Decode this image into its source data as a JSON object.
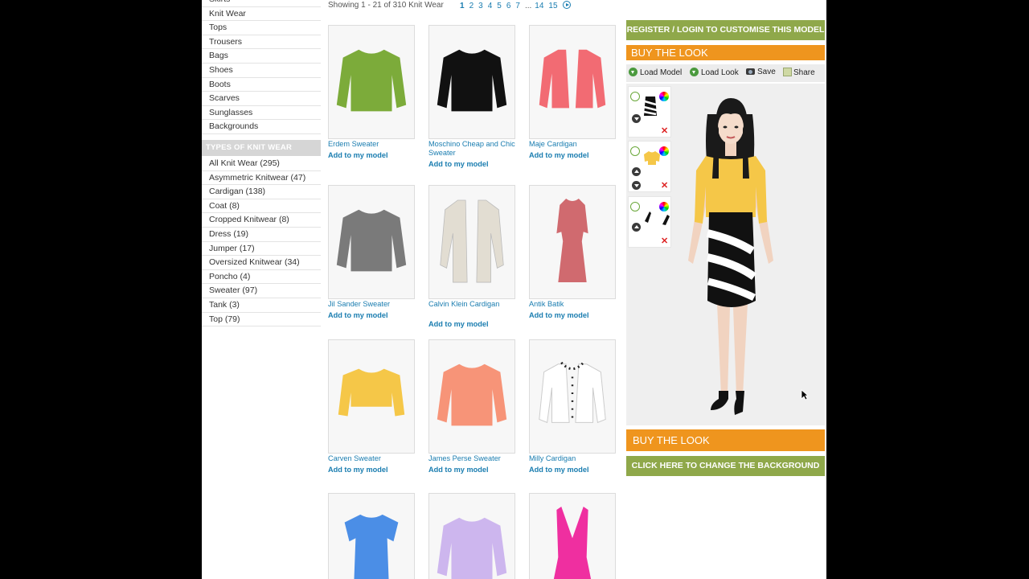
{
  "sidebar": {
    "categories": [
      "Skirts",
      "Knit Wear",
      "Tops",
      "Trousers",
      "Bags",
      "Shoes",
      "Boots",
      "Scarves",
      "Sunglasses",
      "Backgrounds"
    ],
    "types_header": "TYPES OF KNIT WEAR",
    "types": [
      "All Knit Wear (295)",
      "Asymmetric Knitwear (47)",
      "Cardigan (138)",
      "Coat (8)",
      "Cropped Knitwear (8)",
      "Dress (19)",
      "Jumper (17)",
      "Oversized Knitwear (34)",
      "Poncho (4)",
      "Sweater (97)",
      "Tank (3)",
      "Top (79)"
    ]
  },
  "results": {
    "info": "Showing 1 - 21 of 310 Knit Wear",
    "pages": [
      "1",
      "2",
      "3",
      "4",
      "5",
      "6",
      "7"
    ],
    "ellipsis": "...",
    "last_pages": [
      "14",
      "15"
    ]
  },
  "add_label": "Add to my model",
  "products": [
    {
      "name": "Erdem Sweater",
      "color": "#7cab3a",
      "shape": "sweater"
    },
    {
      "name": "Moschino Cheap and Chic Sweater",
      "color": "#111111",
      "shape": "sweater"
    },
    {
      "name": "Maje Cardigan",
      "color": "#f26b73",
      "shape": "cardigan"
    },
    {
      "name": "Jil Sander Sweater",
      "color": "#7a7a7a",
      "shape": "sweater"
    },
    {
      "name": "Calvin Klein Cardigan",
      "color": "#e2ddd2",
      "shape": "longcardigan"
    },
    {
      "name": "Antik Batik",
      "color": "#d06a6f",
      "shape": "gown"
    },
    {
      "name": "Carven Sweater",
      "color": "#f5c748",
      "shape": "crop"
    },
    {
      "name": "James Perse Sweater",
      "color": "#f79478",
      "shape": "sweater"
    },
    {
      "name": "Milly Cardigan",
      "color": "#ffffff",
      "shape": "cardigan"
    },
    {
      "name": "",
      "color": "#4b8ee6",
      "shape": "dress"
    },
    {
      "name": "",
      "color": "#cdb6ee",
      "shape": "sweater"
    },
    {
      "name": "",
      "color": "#ef2fa0",
      "shape": "vdress"
    }
  ],
  "panel": {
    "register_label": "REGISTER / LOGIN TO CUSTOMISE THIS MODEL",
    "buy_look_label": "BUY THE LOOK",
    "tools": {
      "load_model": "Load Model",
      "load_look": "Load Look",
      "save": "Save",
      "share": "Share"
    },
    "change_bg_label": "CLICK HERE TO CHANGE THE BACKGROUND"
  },
  "colors": {
    "accent_orange": "#ef951e",
    "accent_green": "#8fa84a",
    "link_blue": "#1a7db0"
  }
}
